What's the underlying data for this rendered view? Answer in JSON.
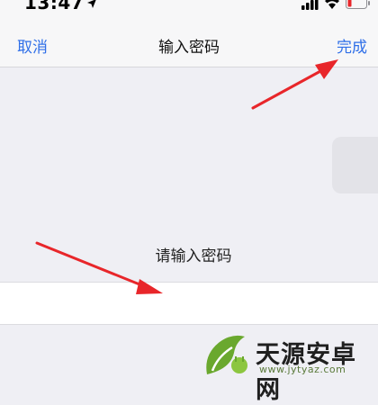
{
  "status_bar": {
    "time": "13:47",
    "icons": [
      "location-arrow-icon",
      "signal-icon",
      "wifi-icon",
      "battery-icon"
    ]
  },
  "nav": {
    "cancel_label": "取消",
    "title": "输入密码",
    "done_label": "完成"
  },
  "main": {
    "prompt": "请输入密码",
    "password_value": ""
  },
  "annotations": [
    "red-arrow-to-done",
    "red-arrow-to-password-field"
  ],
  "watermark": {
    "brand": "天源安卓网",
    "url": "www.jytyaz.com"
  },
  "colors": {
    "accent": "#2f6fe8",
    "background": "#efeff4",
    "annotation": "#e8262a",
    "watermark_green": "#5a9a2a"
  }
}
